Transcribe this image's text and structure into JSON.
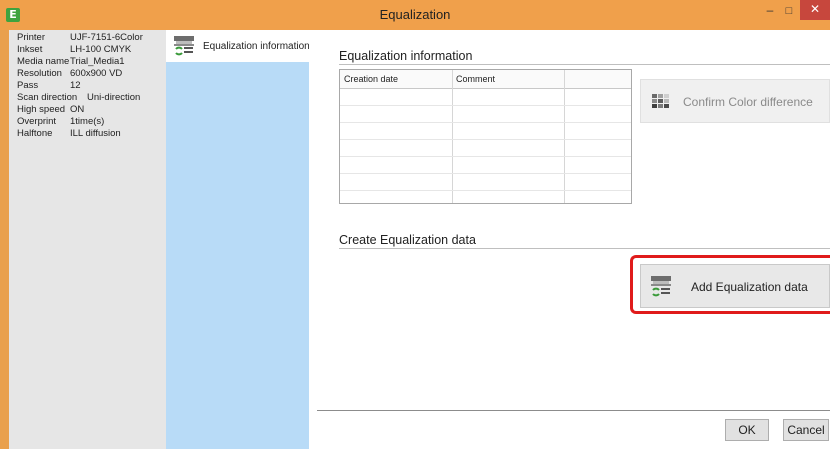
{
  "window": {
    "title": "Equalization",
    "app_icon_glyph": "E",
    "minimize_glyph": "–",
    "maximize_glyph": "□",
    "close_glyph": "✕",
    "colors": {
      "titlebar": "#f0a04b",
      "close": "#c7473d",
      "nav_pane": "#b8dbf7",
      "highlight": "#e01b1b"
    }
  },
  "info": [
    {
      "key": "Printer",
      "value": "UJF-7151-6Color"
    },
    {
      "key": "Inkset",
      "value": "LH-100 CMYK"
    },
    {
      "key": "Media name",
      "value": "Trial_Media1"
    },
    {
      "key": "Resolution",
      "value": "600x900 VD"
    },
    {
      "key": "Pass",
      "value": "12"
    },
    {
      "key": "Scan direction",
      "value": "Uni-direction"
    },
    {
      "key": "High speed",
      "value": "ON"
    },
    {
      "key": "Overprint",
      "value": "1time(s)"
    },
    {
      "key": "Halftone",
      "value": "ILL diffusion"
    }
  ],
  "nav": {
    "items": [
      {
        "label": "Equalization information",
        "icon": "printer-sync-icon"
      }
    ]
  },
  "main": {
    "info_section_title": "Equalization information",
    "table": {
      "columns": [
        "Creation date",
        "Comment",
        ""
      ],
      "rows": []
    },
    "confirm_button": "Confirm Color difference",
    "create_section_title": "Create Equalization data",
    "add_button": "Add Equalization data"
  },
  "footer": {
    "ok": "OK",
    "cancel": "Cancel"
  }
}
